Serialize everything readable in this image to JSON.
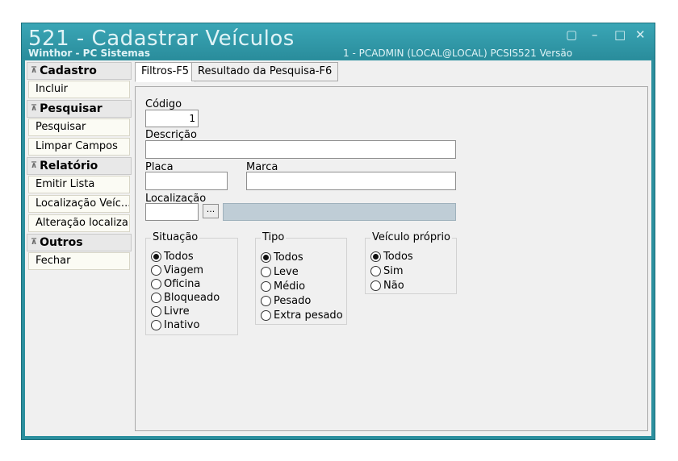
{
  "window": {
    "title": "521 - Cadastrar Veículos",
    "subtitle": "Winthor - PC Sistemas",
    "user_info": "1 - PCADMIN (LOCAL@LOCAL)   PCSIS521   Versão"
  },
  "sidebar": {
    "groups": [
      {
        "label": "Cadastro",
        "items": [
          "Incluir"
        ]
      },
      {
        "label": "Pesquisar",
        "items": [
          "Pesquisar",
          "Limpar Campos"
        ]
      },
      {
        "label": "Relatório",
        "items": [
          "Emitir Lista",
          "Localização Veíc...",
          "Alteração localiza..."
        ]
      },
      {
        "label": "Outros",
        "items": [
          "Fechar"
        ]
      }
    ]
  },
  "tabs": [
    "Filtros-F5",
    "Resultado da Pesquisa-F6"
  ],
  "form": {
    "codigo_label": "Código",
    "codigo_value": "1",
    "descricao_label": "Descrição",
    "descricao_value": "",
    "placa_label": "Placa",
    "marca_label": "Marca",
    "localizacao_label": "Localização",
    "browse_label": "..."
  },
  "situacao": {
    "title": "Situação",
    "options": [
      "Todos",
      "Viagem",
      "Oficina",
      "Bloqueado",
      "Livre",
      "Inativo"
    ],
    "selected": "Todos"
  },
  "tipo": {
    "title": "Tipo",
    "options": [
      "Todos",
      "Leve",
      "Médio",
      "Pesado",
      "Extra pesado"
    ],
    "selected": "Todos"
  },
  "veiculo_proprio": {
    "title": "Veículo próprio",
    "options": [
      "Todos",
      "Sim",
      "Não"
    ],
    "selected": "Todos"
  }
}
